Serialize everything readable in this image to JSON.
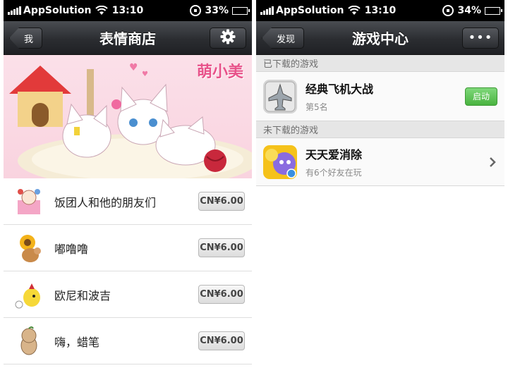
{
  "left": {
    "status_bar": {
      "carrier": "AppSolution",
      "time": "13:10",
      "battery": "33%",
      "battery_level": 0.33
    },
    "nav": {
      "back_label": "我",
      "title": "表情商店",
      "right_icon": "gear-icon"
    },
    "banner": {
      "text": "萌小美"
    },
    "items": [
      {
        "name": "饭团人和他的朋友们",
        "price": "CN¥6.00"
      },
      {
        "name": "嘟噜噜",
        "price": "CN¥6.00"
      },
      {
        "name": "欧尼和波吉",
        "price": "CN¥6.00"
      },
      {
        "name": "嗨，蜡笔",
        "price": "CN¥6.00"
      }
    ]
  },
  "right": {
    "status_bar": {
      "carrier": "AppSolution",
      "time": "13:10",
      "battery": "34%",
      "battery_level": 0.34
    },
    "nav": {
      "back_label": "发现",
      "title": "游戏中心",
      "right_icon": "more-icon"
    },
    "sections": [
      {
        "header": "已下载的游戏",
        "game": {
          "title": "经典飞机大战",
          "subtitle": "第5名",
          "action": "启动"
        }
      },
      {
        "header": "未下载的游戏",
        "game": {
          "title": "天天爱消除",
          "subtitle": "有6个好友在玩"
        }
      }
    ]
  },
  "colors": {
    "launch": "#4fb845",
    "banner_pink": "#f9d3df",
    "nav_dark": "#2b2d31"
  }
}
